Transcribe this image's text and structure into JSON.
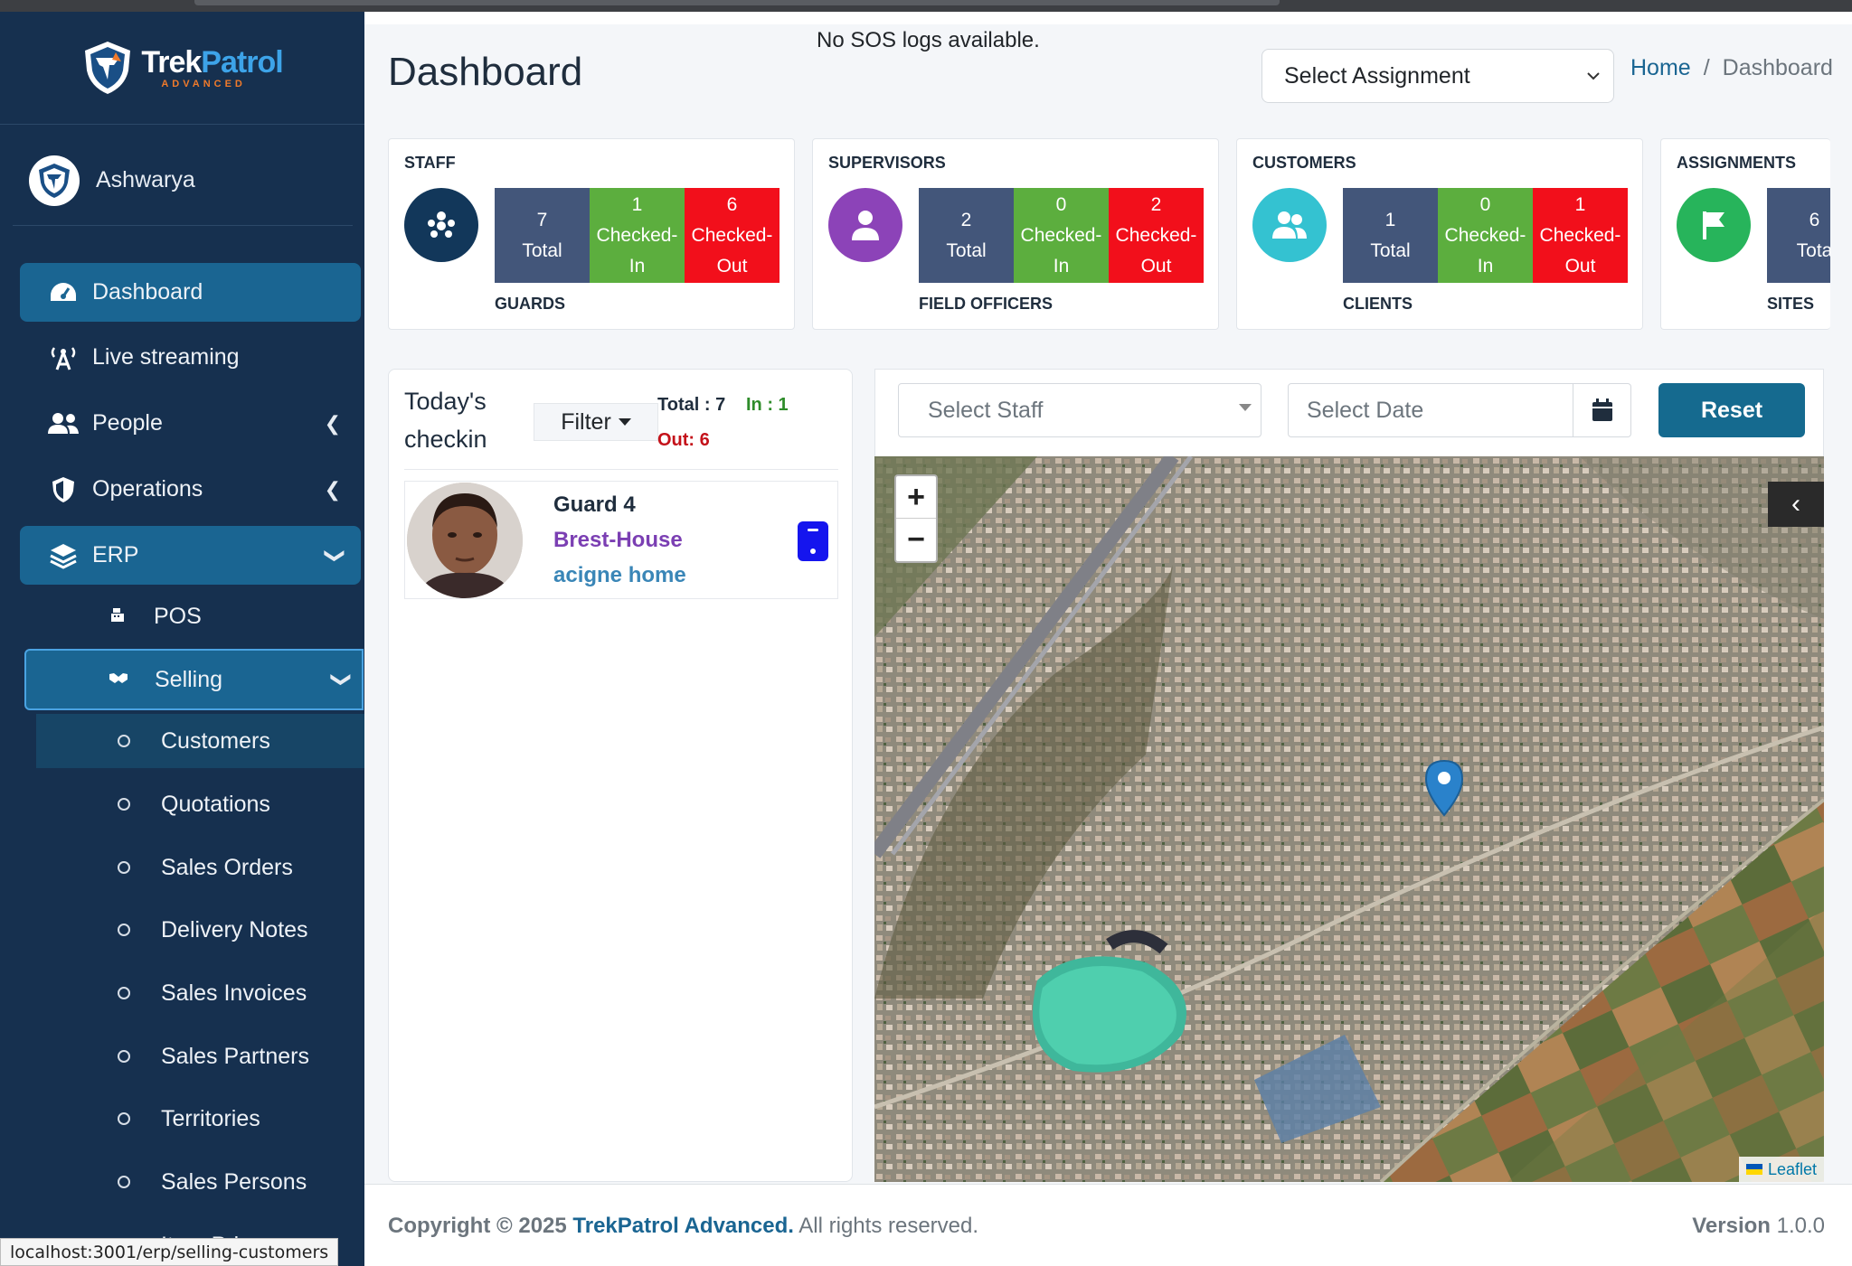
{
  "brand": {
    "name_part1": "Trek",
    "name_part2": "Patrol",
    "tagline": "ADVANCED"
  },
  "user": {
    "name": "Ashwarya"
  },
  "sidebar": {
    "items": [
      {
        "label": "Dashboard",
        "icon": "gauge-icon"
      },
      {
        "label": "Live streaming",
        "icon": "broadcast-icon"
      },
      {
        "label": "People",
        "icon": "users-icon"
      },
      {
        "label": "Operations",
        "icon": "shield-icon"
      },
      {
        "label": "ERP",
        "icon": "layers-icon"
      }
    ],
    "erp_children": [
      {
        "label": "POS",
        "icon": "cash-register-icon"
      },
      {
        "label": "Selling",
        "icon": "handshake-icon"
      }
    ],
    "selling_children": [
      "Customers",
      "Quotations",
      "Sales Orders",
      "Delivery Notes",
      "Sales Invoices",
      "Sales Partners",
      "Territories",
      "Sales Persons",
      "Item Prices"
    ]
  },
  "status_url": "localhost:3001/erp/selling-customers",
  "header": {
    "title": "Dashboard",
    "sos_message": "No SOS logs available.",
    "assignment_select": "Select Assignment",
    "breadcrumb": {
      "home": "Home",
      "separator": "/",
      "current": "Dashboard"
    }
  },
  "cards": [
    {
      "title": "STAFF",
      "total": "7",
      "checked_in": "1",
      "checked_out": "6",
      "footer": "GUARDS",
      "color": "#12375a"
    },
    {
      "title": "SUPERVISORS",
      "total": "2",
      "checked_in": "0",
      "checked_out": "2",
      "footer": "FIELD OFFICERS",
      "color": "#8c43b8"
    },
    {
      "title": "CUSTOMERS",
      "total": "1",
      "checked_in": "0",
      "checked_out": "1",
      "footer": "CLIENTS",
      "color": "#34c2d1"
    },
    {
      "title": "ASSIGNMENTS",
      "total": "6",
      "checked_in": "",
      "checked_out": "",
      "footer": "SITES",
      "color": "#27b45b"
    }
  ],
  "card_labels": {
    "total": "Total",
    "checked_in_1": "Checked-",
    "checked_in_2": "In",
    "checked_out_1": "Checked-",
    "checked_out_2": "Out",
    "total_clipped": "Tota"
  },
  "checkin": {
    "title_line1": "Today's",
    "title_line2": "checkin",
    "filter_label": "Filter",
    "total_label": "Total : 7",
    "in_label": "In : 1",
    "out_label": "Out: 6",
    "guard": {
      "name": "Guard 4",
      "site": "Brest-House",
      "address": "acigne home"
    }
  },
  "map_filters": {
    "staff_placeholder": "Select Staff",
    "date_placeholder": "Select Date",
    "reset_label": "Reset"
  },
  "map": {
    "zoom_in": "+",
    "zoom_out": "−",
    "toggle": "‹",
    "attribution": "Leaflet"
  },
  "footer": {
    "copyright_prefix": "Copyright © 2025",
    "company": "TrekPatrol Advanced.",
    "rights": "All rights reserved.",
    "version_label": "Version",
    "version_value": "1.0.0"
  }
}
